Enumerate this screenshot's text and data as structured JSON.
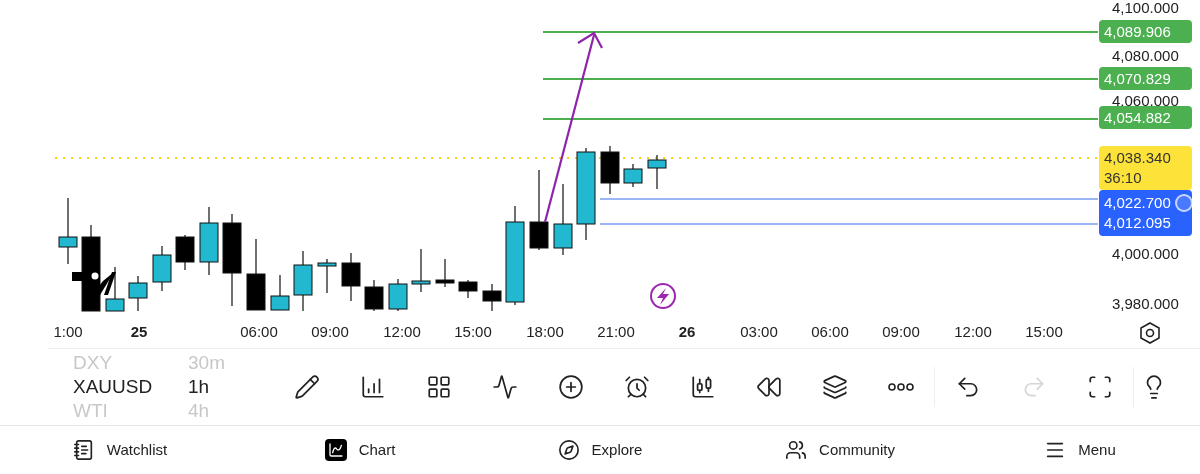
{
  "price_axis": {
    "labels": [
      "4,100.000",
      "4,080.000",
      "4,060.000",
      "4,000.000",
      "3,980.000"
    ],
    "tags": [
      {
        "lines": [
          "4,089.906"
        ],
        "color": "#4caf50"
      },
      {
        "lines": [
          "4,070.829"
        ],
        "color": "#4caf50"
      },
      {
        "lines": [
          "4,054.882"
        ],
        "color": "#4caf50"
      },
      {
        "lines": [
          "4,038.340",
          "36:10"
        ],
        "color": "#fde23a"
      },
      {
        "lines": [
          "4,022.700",
          "4,012.095"
        ],
        "color": "#2962ff"
      }
    ]
  },
  "time_axis": [
    {
      "text": "1:00",
      "kind": "time"
    },
    {
      "text": "25",
      "kind": "day"
    },
    {
      "text": "06:00",
      "kind": "time"
    },
    {
      "text": "09:00",
      "kind": "time"
    },
    {
      "text": "12:00",
      "kind": "time"
    },
    {
      "text": "15:00",
      "kind": "time"
    },
    {
      "text": "18:00",
      "kind": "time"
    },
    {
      "text": "21:00",
      "kind": "time"
    },
    {
      "text": "26",
      "kind": "day"
    },
    {
      "text": "03:00",
      "kind": "time"
    },
    {
      "text": "06:00",
      "kind": "time"
    },
    {
      "text": "09:00",
      "kind": "time"
    },
    {
      "text": "12:00",
      "kind": "time"
    },
    {
      "text": "15:00",
      "kind": "time"
    }
  ],
  "symbols": [
    {
      "symbol": "DXY",
      "interval": "30m",
      "selected": false
    },
    {
      "symbol": "XAUUSD",
      "interval": "1h",
      "selected": true
    },
    {
      "symbol": "WTI",
      "interval": "4h",
      "selected": false
    }
  ],
  "toolbar": [
    {
      "disabled": false
    },
    {
      "disabled": false
    },
    {
      "disabled": false
    },
    {
      "disabled": false
    },
    {
      "disabled": false
    },
    {
      "disabled": false
    },
    {
      "disabled": false
    },
    {
      "disabled": false
    },
    {
      "disabled": false
    },
    {
      "disabled": false
    },
    {
      "disabled": false
    },
    {
      "disabled": true
    },
    {
      "disabled": false
    },
    {
      "disabled": false
    }
  ],
  "nav": [
    {
      "label": "Watchlist",
      "selected": false
    },
    {
      "label": "Chart",
      "selected": true
    },
    {
      "label": "Explore",
      "selected": false
    },
    {
      "label": "Community",
      "selected": false
    },
    {
      "label": "Menu",
      "selected": false
    }
  ]
}
